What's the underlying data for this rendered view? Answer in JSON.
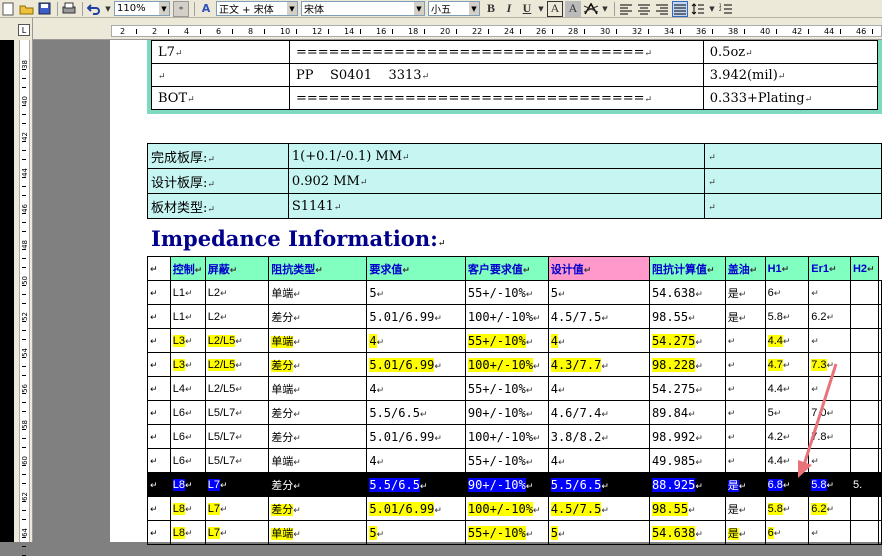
{
  "toolbar": {
    "zoom": "110%",
    "style": "正文 + 宋体",
    "font": "宋体",
    "size": "小五",
    "bold": "B",
    "italic": "I",
    "underline": "U",
    "charborder": "A",
    "charshade": "A"
  },
  "ruler": {
    "corner": "L",
    "top_numbers": [
      "2",
      "2",
      "4",
      "6",
      "8",
      "10",
      "12",
      "14",
      "16",
      "18",
      "20",
      "22",
      "24",
      "26",
      "28",
      "30",
      "32",
      "34",
      "36",
      "38",
      "40",
      "42",
      "44",
      "46"
    ],
    "left_numbers": [
      "38",
      "40",
      "42",
      "44",
      "46",
      "48",
      "50",
      "52",
      "54",
      "56",
      "58",
      "60",
      "62",
      "64"
    ]
  },
  "stackup": [
    {
      "layer": "L7",
      "mark1": "↵",
      "line": "================================",
      "mark2": "↵",
      "thick": "0.5oz",
      "mark3": "↵"
    },
    {
      "layer": "",
      "mark1": "↵",
      "line": "PP    S0401    3313",
      "mark2": "↵",
      "thick": "3.942(mil)",
      "mark3": "↵"
    },
    {
      "layer": "BOT",
      "mark1": "↵",
      "line": "================================",
      "mark2": "↵",
      "thick": "0.333+Plating",
      "mark3": "↵"
    }
  ],
  "info": [
    {
      "label": "完成板厚:",
      "value": "1(+0.1/-0.1) MM",
      "extra": ""
    },
    {
      "label": "设计板厚:",
      "value": "0.902 MM",
      "extra": ""
    },
    {
      "label": "板材类型:",
      "value": "S1141",
      "extra": ""
    }
  ],
  "impedance": {
    "title": "Impedance Information:",
    "headers": [
      "控制",
      "屏蔽",
      "阻抗类型",
      "要求值",
      "客户要求值",
      "设计值",
      "阻抗计算值",
      "盖油",
      "H1",
      "Er1",
      "H2"
    ],
    "rows": [
      {
        "style": "",
        "cells": [
          "L1",
          "L2",
          "单端",
          "5",
          "55+/-10%",
          "5",
          "54.638",
          "是",
          "6",
          "",
          ""
        ]
      },
      {
        "style": "",
        "cells": [
          "L1",
          "L2",
          "差分",
          "5.01/6.99",
          "100+/-10%",
          "4.5/7.5",
          "98.55",
          "是",
          "5.8",
          "6.2",
          ""
        ]
      },
      {
        "style": "y",
        "cells": [
          "L3",
          "L2/L5",
          "单端",
          "4",
          "55+/-10%",
          "4",
          "54.275",
          "",
          "4.4",
          "",
          ""
        ]
      },
      {
        "style": "y",
        "cells": [
          "L3",
          "L2/L5",
          "差分",
          "5.01/6.99",
          "100+/-10%",
          "4.3/7.7",
          "98.228",
          "",
          "4.7",
          "7.3",
          ""
        ]
      },
      {
        "style": "",
        "cells": [
          "L4",
          "L2/L5",
          "单端",
          "4",
          "55+/-10%",
          "4",
          "54.275",
          "",
          "4.4",
          "",
          ""
        ]
      },
      {
        "style": "",
        "cells": [
          "L6",
          "L5/L7",
          "差分",
          "5.5/6.5",
          "90+/-10%",
          "4.6/7.4",
          "89.84",
          "",
          "5",
          "7.0",
          ""
        ]
      },
      {
        "style": "",
        "cells": [
          "L6",
          "L5/L7",
          "差分",
          "5.01/6.99",
          "100+/-10%",
          "3.8/8.2",
          "98.992",
          "",
          "4.2",
          "7.8",
          ""
        ]
      },
      {
        "style": "",
        "cells": [
          "L6",
          "L5/L7",
          "单端",
          "4",
          "55+/-10%",
          "4",
          "49.985",
          "",
          "4.4",
          "",
          ""
        ]
      },
      {
        "style": "b",
        "cells": [
          "L8",
          "L7",
          "差分",
          "5.5/6.5",
          "90+/-10%",
          "5.5/6.5",
          "88.925",
          "是",
          "6.8",
          "5.8",
          "5."
        ]
      },
      {
        "style": "y",
        "cells": [
          "L8",
          "L7",
          "差分",
          "5.01/6.99",
          "100+/-10%",
          "4.5/7.5",
          "98.55",
          "是",
          "5.8",
          "6.2",
          ""
        ]
      },
      {
        "style": "y",
        "cells": [
          "L8",
          "L7",
          "单端",
          "5",
          "55+/-10%",
          "5",
          "54.638",
          "是",
          "6",
          "",
          ""
        ]
      }
    ]
  },
  "colors": {
    "cyan": "#c6f5f2",
    "yellow": "#ffff00",
    "blue": "#0000ff",
    "arrow": "#e8737a"
  }
}
